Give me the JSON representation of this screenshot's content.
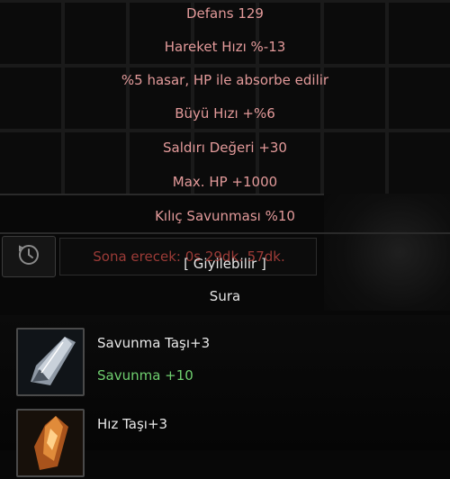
{
  "tooltip": {
    "stats": [
      "Defans 129",
      "Hareket Hızı %-13",
      "%5 hasar, HP ile absorbe edilir",
      "Büyü Hızı +%6",
      "Saldırı Değeri +30",
      "Max. HP +1000",
      "Kılıç Savunması %10"
    ],
    "expiry_text": "Sona erecek: 0s 29dk. 57dk.",
    "wearable_label": "[ Giyilebilir ]",
    "class_label": "Sura"
  },
  "icons": {
    "timer": "timer-icon",
    "stone1": "defense-stone-icon",
    "stone2": "speed-stone-icon"
  },
  "stones": [
    {
      "name": "Savunma Taşı+3",
      "bonus": "Savunma +10"
    },
    {
      "name": "Hız Taşı+3",
      "bonus": ""
    }
  ],
  "colors": {
    "stat_text": "#e39a9a",
    "expiry_text": "#9c3b37",
    "bonus_text": "#6fcf6f",
    "name_text": "#e6e6e6"
  }
}
